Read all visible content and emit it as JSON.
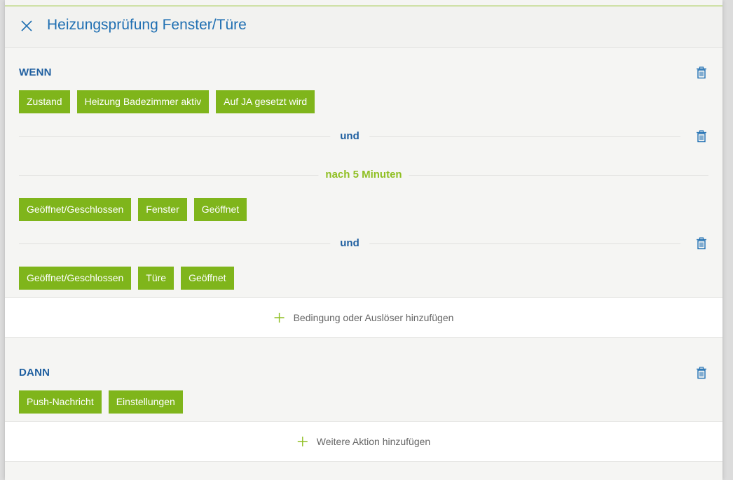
{
  "header": {
    "title": "Heizungsprüfung Fenster/Türe"
  },
  "if_section": {
    "label": "WENN",
    "condition_1": [
      "Zustand",
      "Heizung Badezimmer aktiv",
      "Auf JA gesetzt wird"
    ],
    "connector_1": "und",
    "delay": "nach 5 Minuten",
    "condition_2": [
      "Geöffnet/Geschlossen",
      "Fenster",
      "Geöffnet"
    ],
    "connector_2": "und",
    "condition_3": [
      "Geöffnet/Geschlossen",
      "Türe",
      "Geöffnet"
    ],
    "add_label": "Bedingung oder Auslöser hinzufügen"
  },
  "then_section": {
    "label": "DANN",
    "actions": [
      "Push-Nachricht",
      "Einstellungen"
    ],
    "add_label": "Weitere Aktion hinzufügen"
  },
  "colors": {
    "accent_green": "#7fb51b",
    "title_blue": "#1f6fb2",
    "label_blue": "#1f5fa0",
    "delay_green": "#8fbf22"
  }
}
